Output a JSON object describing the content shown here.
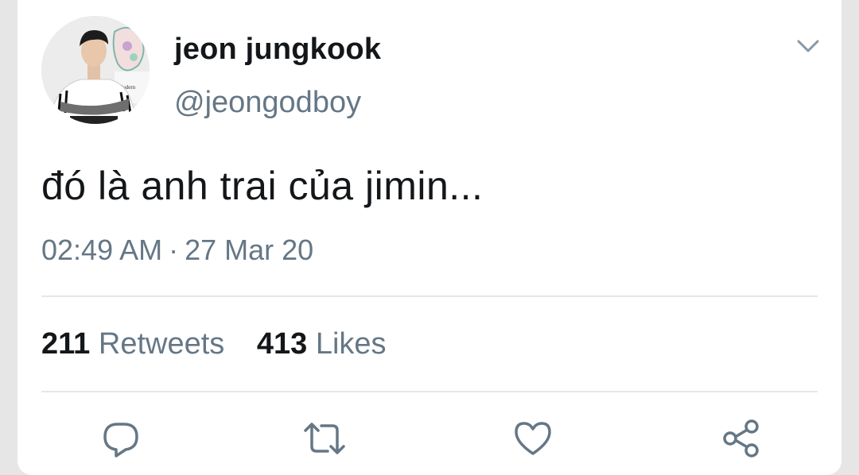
{
  "tweet": {
    "author_name": "jeon jungkook",
    "author_handle": "@jeongodboy",
    "text": "đó là anh trai của jimin...",
    "time": "02:49 AM",
    "separator": "·",
    "date": "27 Mar 20"
  },
  "stats": {
    "retweets_count": "211",
    "retweets_label": "Retweets",
    "likes_count": "413",
    "likes_label": "Likes"
  },
  "avatar": {
    "sign_text": "Modern"
  },
  "icons": {
    "menu": "chevron-down-icon",
    "reply": "reply-icon",
    "retweet": "retweet-icon",
    "like": "heart-icon",
    "share": "share-icon"
  },
  "colors": {
    "primary_text": "#14171a",
    "secondary_text": "#657786",
    "divider": "#e1e8ed"
  }
}
